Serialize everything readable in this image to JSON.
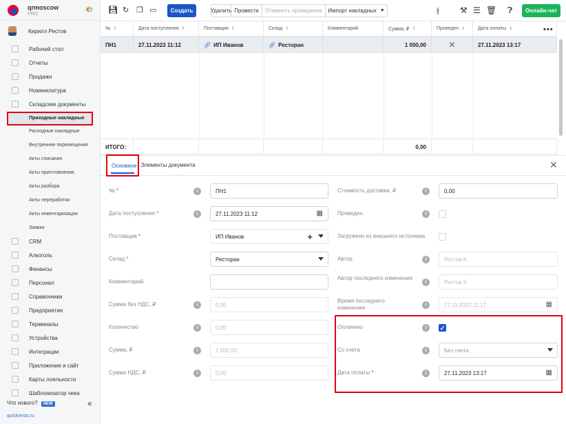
{
  "brand": {
    "name": "qrmoscow",
    "plan": "PRO"
  },
  "user": {
    "name": "Кирилл Рестов"
  },
  "sidebar": {
    "items": [
      {
        "label": "Рабочий стол"
      },
      {
        "label": "Отчеты"
      },
      {
        "label": "Продажи"
      },
      {
        "label": "Номенклатура"
      },
      {
        "label": "Складские документы"
      }
    ],
    "subitems": [
      {
        "label": "Приходные накладные"
      },
      {
        "label": "Расходные накладные"
      },
      {
        "label": "Внутренние перемещения"
      },
      {
        "label": "Акты списания"
      },
      {
        "label": "Акты приготовления"
      },
      {
        "label": "Акты разбора"
      },
      {
        "label": "Акты переработки"
      },
      {
        "label": "Акты инвентаризации"
      },
      {
        "label": "Заявки"
      }
    ],
    "items2": [
      {
        "label": "CRM"
      },
      {
        "label": "Алкоголь"
      },
      {
        "label": "Финансы"
      },
      {
        "label": "Персонал"
      },
      {
        "label": "Справочники"
      },
      {
        "label": "Предприятие"
      },
      {
        "label": "Терминалы"
      },
      {
        "label": "Устройства"
      },
      {
        "label": "Интеграции"
      },
      {
        "label": "Приложение и сайт"
      },
      {
        "label": "Карты лояльности"
      },
      {
        "label": "Шаблонизатор чека"
      }
    ],
    "whats_new": "Что нового?",
    "new_badge": "NEW",
    "site": "quickresto.ru"
  },
  "toolbar": {
    "create": "Создать",
    "delete": "Удалить",
    "post": "Провести",
    "unpost": "Отменить проведение",
    "import": "Импорт накладных",
    "online_chat": "Онлайн-чат"
  },
  "table": {
    "columns": [
      "№",
      "Дата поступления",
      "Поставщик",
      "Склад",
      "Комментарий",
      "Сумма, ₽",
      "Проведен",
      "Дата оплаты"
    ],
    "row": {
      "num": "ПН1",
      "date": "27.11.2023 11:12",
      "supplier": "ИП Иванов",
      "warehouse": "Ресторан",
      "comment": "",
      "sum": "1 000,00",
      "posted": "✕",
      "pay_date": "27.11.2023 13:17"
    },
    "total_label": "ИТОГО:",
    "total_sum": "0,00"
  },
  "tabs": {
    "main": "Основное",
    "elements": "Элементы документа"
  },
  "form": {
    "num_label": "№",
    "num_value": "ПН1",
    "date_label": "Дата поступления",
    "date_value": "27.11.2023 11:12",
    "supplier_label": "Поставщик",
    "supplier_value": "ИП Иванов",
    "warehouse_label": "Склад",
    "warehouse_value": "Ресторан",
    "comment_label": "Комментарий",
    "sum_novat_label": "Сумма без НДС, ₽",
    "sum_novat_value": "0,00",
    "qty_label": "Количество",
    "qty_value": "0,00",
    "sum_label": "Сумма, ₽",
    "sum_value": "1 000,00",
    "vat_label": "Сумма НДС, ₽",
    "vat_value": "0,00",
    "delivery_label": "Стоимость доставки, ₽",
    "delivery_value": "0,00",
    "posted_label": "Проведен",
    "external_label": "Загружено из внешнего источника",
    "author_label": "Автор",
    "author_value": "Рестов К.",
    "last_author_label": "Автор последнего изменения",
    "last_author_value": "Рестов К.",
    "last_time_label": "Время последнего изменения",
    "last_time_value": "27.11.2023 11:17",
    "paid_label": "Оплачено",
    "account_label": "Со счета",
    "account_value": "Без счета",
    "pay_date_label": "Дата оплаты",
    "pay_date_value": "27.11.2023 13:17"
  },
  "colors": {
    "primary": "#1c55c9",
    "green": "#1bb35a",
    "highlight": "#e00010"
  }
}
